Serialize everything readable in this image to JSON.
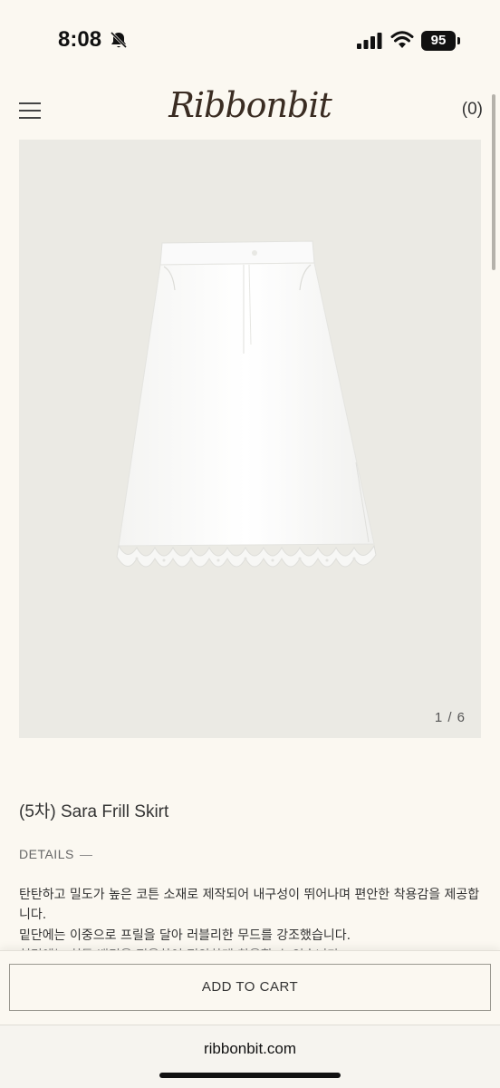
{
  "status_bar": {
    "time": "8:08",
    "battery": "95"
  },
  "header": {
    "logo": "Ribbonbit",
    "cart_count": "(0)"
  },
  "gallery": {
    "counter": "1 / 6"
  },
  "product": {
    "title": "(5차) Sara Frill Skirt",
    "details_label": "DETAILS",
    "details_toggle": "—",
    "description_line1": "탄탄하고 밀도가 높은 코튼 소재로 제작되어 내구성이 뛰어나며 편안한 착용감을 제공합니다.",
    "description_line2": "밑단에는 이중으로 프릴을 달아 러블리한 무드를 강조했습니다.",
    "description_line3": "허리에는 히든 밴딩을 적용하여 편안하게 착용할 수 있습니다."
  },
  "actions": {
    "add_to_cart": "ADD TO CART"
  },
  "browser": {
    "url": "ribbonbit.com"
  },
  "colors": {
    "background": "#fbf8f1",
    "image_bg": "#ebeae4",
    "text": "#333333"
  }
}
